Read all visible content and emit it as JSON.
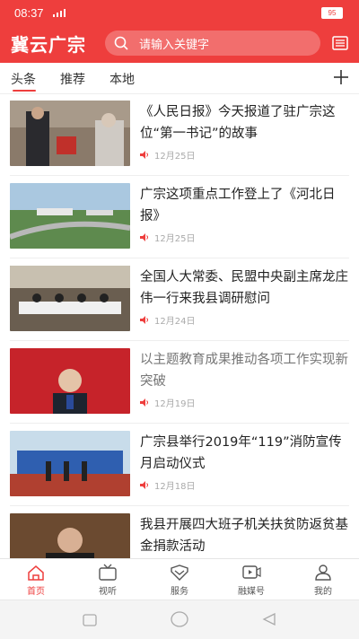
{
  "status": {
    "time": "08:37",
    "battery": "95"
  },
  "header": {
    "logo": "冀云广宗",
    "search_placeholder": "请输入关键字"
  },
  "tabs": [
    {
      "label": "头条"
    },
    {
      "label": "推荐"
    },
    {
      "label": "本地"
    }
  ],
  "news": [
    {
      "title": "《人民日报》今天报道了驻广宗这位“第一书记”的故事",
      "date": "12月25日"
    },
    {
      "title": "广宗这项重点工作登上了《河北日报》",
      "date": "12月25日"
    },
    {
      "title": "全国人大常委、民盟中央副主席龙庄伟一行来我县调研慰问",
      "date": "12月24日"
    },
    {
      "title": "以主题教育成果推动各项工作实现新突破",
      "date": "12月19日"
    },
    {
      "title": "广宗县举行2019年“119”消防宣传月启动仪式",
      "date": "12月18日"
    },
    {
      "title": "我县开展四大班子机关扶贫防返贫基金捐款活动",
      "date": ""
    }
  ],
  "tabbar": [
    {
      "label": "首页"
    },
    {
      "label": "视听"
    },
    {
      "label": "服务"
    },
    {
      "label": "融媒号"
    },
    {
      "label": "我的"
    }
  ],
  "colors": {
    "brand": "#ee3e3d"
  }
}
